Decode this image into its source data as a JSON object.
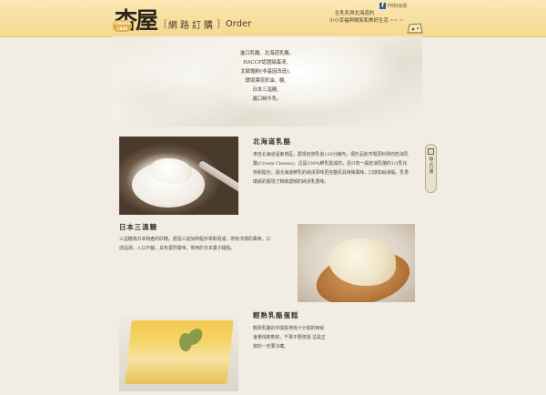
{
  "header": {
    "logo_text": "杏屋",
    "logo_badge": "CHEESE CAKE",
    "nav_cn": "網路訂購",
    "nav_en": "Order",
    "fb_label": "FB粉絲團",
    "slogan_line1": "生乳乳與北海道的",
    "slogan_line2": "小小幸福與微笑和美好生活 ~~ ~"
  },
  "hero": {
    "lines": [
      "進口乳酪、北海道乳酪、",
      "HACCP認證級蛋清、",
      "北歐麵粉(非基因改造)、",
      "環境漂流奶油、糖、",
      "日本三溫糖、",
      "進口純牛乳。"
    ]
  },
  "side_tab": {
    "label": "線上訂購"
  },
  "sections": [
    {
      "title": "北海道乳酪",
      "body": "來自北海道遠東地區，農場自擠乳後120分鐘內，便於品館市場原料熟的奶油乳酪(Cream Cheese)。這是100%鮮乳製成的，且只有一般奶油乳酪的1/3乳化劑和脂份，讓北海道鮮乳的純淨原味更完整而具特殊風味，口感如絲滑般，乳香環繞的展現了精緻濃郁的純淨乳香味。"
    },
    {
      "title": "日本三溫糖",
      "body": "三溫糖為日本特產的砂糖，經過三道加熱程序萃取而成，帶有淳樸的風味，口感溫潤，入口不膩，具有濃烈甜味，常用於日本菓子甜點。"
    },
    {
      "title": "輕熟乳酪蛋糕",
      "body": "輕熟乳酪的中間質地有汁分間的時候會覺得軟軟的，千萬不要懷疑 這是正常的一定要冷藏。"
    }
  ]
}
